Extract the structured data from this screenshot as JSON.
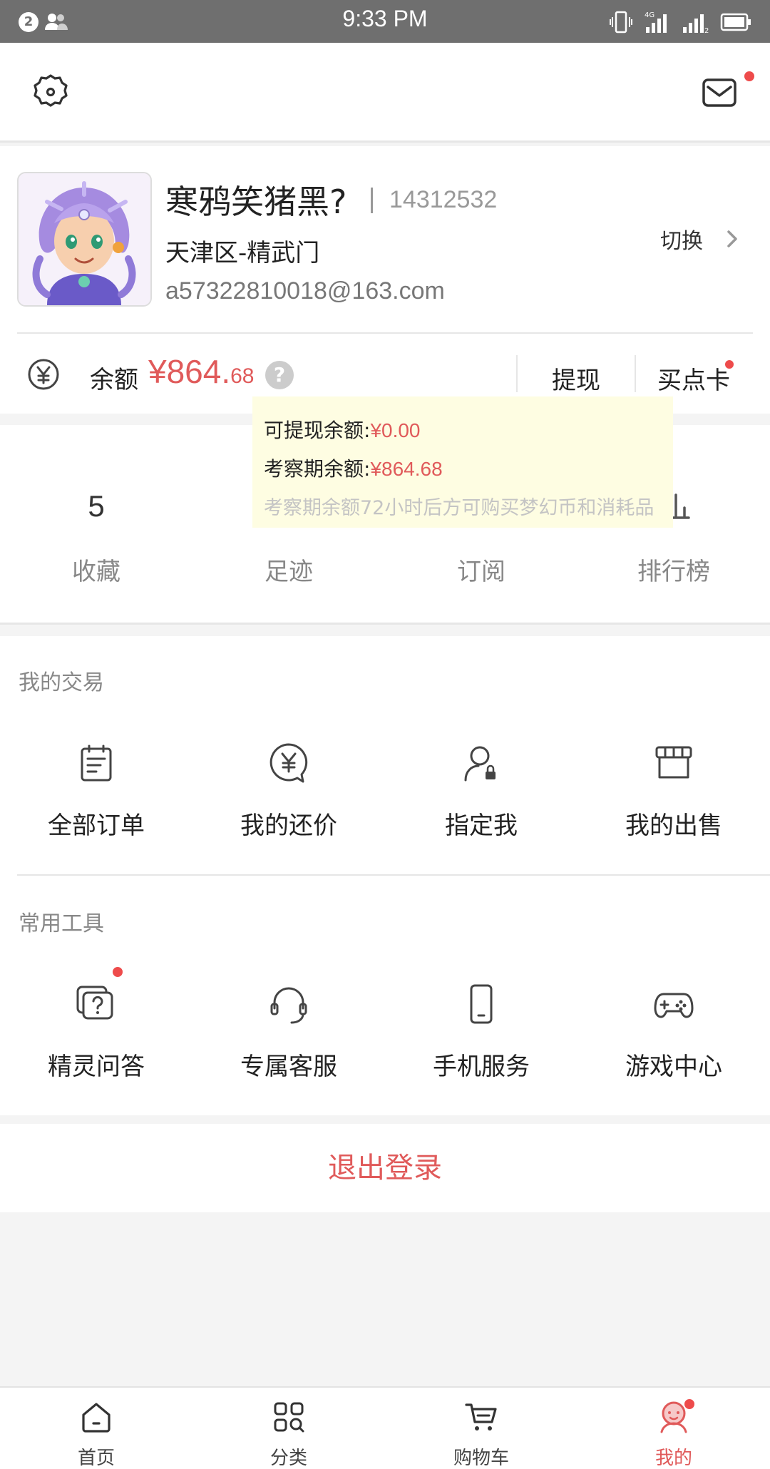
{
  "status_bar": {
    "notification_count": "2",
    "time": "9:33 PM",
    "network_label": "4G",
    "sim2_label": "2"
  },
  "top_bar": {
    "settings_icon": "gear-icon",
    "mail_icon": "mail-icon"
  },
  "profile": {
    "nickname": "寒鸦笑猪黑?",
    "user_id": "14312532",
    "server": "天津区-精武门",
    "email": "a57322810018@163.com",
    "switch_label": "切换"
  },
  "balance": {
    "label": "余额",
    "amount_main": "¥864.",
    "amount_cents": "68",
    "help": "?",
    "withdraw_label": "提现",
    "buy_card_label": "买点卡"
  },
  "tooltip": {
    "withdrawable_label": "可提现余额:",
    "withdrawable_value": "¥0.00",
    "review_label": "考察期余额:",
    "review_value": "¥864.68",
    "note": "考察期余额72小时后方可购买梦幻币和消耗品"
  },
  "stats": {
    "favorites_count": "5",
    "favorites_label": "收藏",
    "footprints_label": "足迹",
    "subscribe_label": "订阅",
    "ranking_label": "排行榜"
  },
  "my_trades": {
    "title": "我的交易",
    "items": [
      {
        "label": "全部订单",
        "icon": "clipboard-icon"
      },
      {
        "label": "我的还价",
        "icon": "yuan-bubble-icon"
      },
      {
        "label": "指定我",
        "icon": "user-lock-icon"
      },
      {
        "label": "我的出售",
        "icon": "store-icon"
      }
    ]
  },
  "tools": {
    "title": "常用工具",
    "items": [
      {
        "label": "精灵问答",
        "icon": "question-chat-icon"
      },
      {
        "label": "专属客服",
        "icon": "headset-icon"
      },
      {
        "label": "手机服务",
        "icon": "phone-icon"
      },
      {
        "label": "游戏中心",
        "icon": "gamepad-icon"
      }
    ]
  },
  "logout_label": "退出登录",
  "bottom_nav": {
    "items": [
      {
        "label": "首页",
        "icon": "home-icon"
      },
      {
        "label": "分类",
        "icon": "category-icon"
      },
      {
        "label": "购物车",
        "icon": "cart-icon"
      },
      {
        "label": "我的",
        "icon": "profile-icon"
      }
    ]
  },
  "colors": {
    "accent": "#e05a5a",
    "notification_dot": "#ee4b4b",
    "tooltip_bg": "#fefde2",
    "status_bar_bg": "#6f6f6f"
  }
}
